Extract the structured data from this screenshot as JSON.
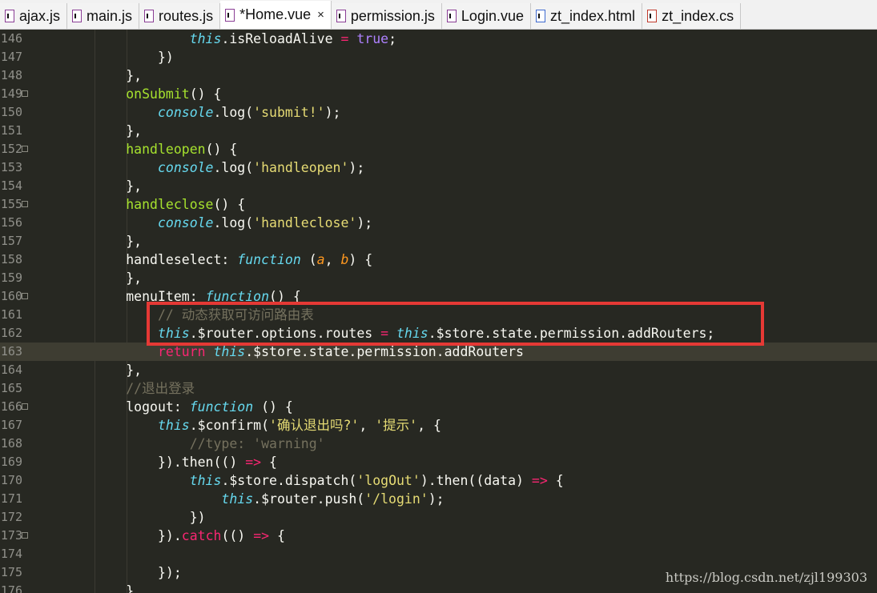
{
  "tabs": [
    {
      "label": "ajax.js",
      "icon": "js-file-icon",
      "active": false
    },
    {
      "label": "main.js",
      "icon": "js-file-icon",
      "active": false
    },
    {
      "label": "routes.js",
      "icon": "js-file-icon",
      "active": false
    },
    {
      "label": "*Home.vue",
      "icon": "vue-file-icon",
      "active": true,
      "close": "×"
    },
    {
      "label": "permission.js",
      "icon": "js-file-icon",
      "active": false
    },
    {
      "label": "Login.vue",
      "icon": "vue-file-icon",
      "active": false
    },
    {
      "label": "zt_index.html",
      "icon": "html-file-icon",
      "active": false
    },
    {
      "label": "zt_index.cs",
      "icon": "css-file-icon",
      "active": false
    }
  ],
  "lines": [
    {
      "n": "146",
      "fold": false,
      "indent": "        ",
      "tokens": [
        [
          "this",
          "this"
        ],
        [
          ".isReloadAlive ",
          "plain"
        ],
        [
          "=",
          "op"
        ],
        [
          " ",
          "plain"
        ],
        [
          "true",
          "bool"
        ],
        [
          ";",
          "plain"
        ]
      ]
    },
    {
      "n": "147",
      "fold": false,
      "indent": "    ",
      "tokens": [
        [
          "})",
          "plain"
        ]
      ]
    },
    {
      "n": "148",
      "fold": false,
      "indent": "",
      "tokens": [
        [
          "},",
          "plain"
        ]
      ]
    },
    {
      "n": "149",
      "fold": true,
      "indent": "",
      "tokens": [
        [
          "onSubmit",
          "fn"
        ],
        [
          "() {",
          "plain"
        ]
      ]
    },
    {
      "n": "150",
      "fold": false,
      "indent": "    ",
      "tokens": [
        [
          "console",
          "this"
        ],
        [
          ".log(",
          "plain"
        ],
        [
          "'submit!'",
          "str"
        ],
        [
          ");",
          "plain"
        ]
      ]
    },
    {
      "n": "151",
      "fold": false,
      "indent": "",
      "tokens": [
        [
          "},",
          "plain"
        ]
      ]
    },
    {
      "n": "152",
      "fold": true,
      "indent": "",
      "tokens": [
        [
          "handleopen",
          "fn"
        ],
        [
          "() {",
          "plain"
        ]
      ]
    },
    {
      "n": "153",
      "fold": false,
      "indent": "    ",
      "tokens": [
        [
          "console",
          "this"
        ],
        [
          ".log(",
          "plain"
        ],
        [
          "'handleopen'",
          "str"
        ],
        [
          ");",
          "plain"
        ]
      ]
    },
    {
      "n": "154",
      "fold": false,
      "indent": "",
      "tokens": [
        [
          "},",
          "plain"
        ]
      ]
    },
    {
      "n": "155",
      "fold": true,
      "indent": "",
      "tokens": [
        [
          "handleclose",
          "fn"
        ],
        [
          "() {",
          "plain"
        ]
      ]
    },
    {
      "n": "156",
      "fold": false,
      "indent": "    ",
      "tokens": [
        [
          "console",
          "this"
        ],
        [
          ".log(",
          "plain"
        ],
        [
          "'handleclose'",
          "str"
        ],
        [
          ");",
          "plain"
        ]
      ]
    },
    {
      "n": "157",
      "fold": false,
      "indent": "",
      "tokens": [
        [
          "},",
          "plain"
        ]
      ]
    },
    {
      "n": "158",
      "fold": false,
      "indent": "",
      "tokens": [
        [
          "handleselect: ",
          "plain"
        ],
        [
          "function",
          "this"
        ],
        [
          " (",
          "plain"
        ],
        [
          "a",
          "param"
        ],
        [
          ", ",
          "plain"
        ],
        [
          "b",
          "param"
        ],
        [
          ") {",
          "plain"
        ]
      ]
    },
    {
      "n": "159",
      "fold": false,
      "indent": "",
      "tokens": [
        [
          "},",
          "plain"
        ]
      ]
    },
    {
      "n": "160",
      "fold": true,
      "indent": "",
      "tokens": [
        [
          "menuItem: ",
          "plain"
        ],
        [
          "function",
          "this"
        ],
        [
          "() {",
          "plain"
        ]
      ]
    },
    {
      "n": "161",
      "fold": false,
      "indent": "    ",
      "tokens": [
        [
          "// 动态获取可访问路由表",
          "com"
        ]
      ]
    },
    {
      "n": "162",
      "fold": false,
      "indent": "    ",
      "tokens": [
        [
          "this",
          "this"
        ],
        [
          ".$router.options.routes ",
          "plain"
        ],
        [
          "=",
          "op"
        ],
        [
          " ",
          "plain"
        ],
        [
          "this",
          "this"
        ],
        [
          ".$store.state.permission.addRouters;",
          "plain"
        ]
      ]
    },
    {
      "n": "163",
      "fold": false,
      "indent": "    ",
      "current": true,
      "tokens": [
        [
          "return",
          "key"
        ],
        [
          " ",
          "plain"
        ],
        [
          "this",
          "this"
        ],
        [
          ".$store.state.permission.addRouters",
          "plain"
        ]
      ]
    },
    {
      "n": "164",
      "fold": false,
      "indent": "",
      "tokens": [
        [
          "},",
          "plain"
        ]
      ]
    },
    {
      "n": "165",
      "fold": false,
      "indent": "",
      "tokens": [
        [
          "//退出登录",
          "com"
        ]
      ]
    },
    {
      "n": "166",
      "fold": true,
      "indent": "",
      "tokens": [
        [
          "logout: ",
          "plain"
        ],
        [
          "function",
          "this"
        ],
        [
          " () {",
          "plain"
        ]
      ]
    },
    {
      "n": "167",
      "fold": false,
      "indent": "    ",
      "tokens": [
        [
          "this",
          "this"
        ],
        [
          ".$confirm(",
          "plain"
        ],
        [
          "'确认退出吗?'",
          "str"
        ],
        [
          ", ",
          "plain"
        ],
        [
          "'提示'",
          "str"
        ],
        [
          ", {",
          "plain"
        ]
      ]
    },
    {
      "n": "168",
      "fold": false,
      "indent": "        ",
      "tokens": [
        [
          "//type: 'warning'",
          "com"
        ]
      ]
    },
    {
      "n": "169",
      "fold": false,
      "indent": "    ",
      "tokens": [
        [
          "}).then(() ",
          "plain"
        ],
        [
          "=>",
          "op"
        ],
        [
          " {",
          "plain"
        ]
      ]
    },
    {
      "n": "170",
      "fold": false,
      "indent": "        ",
      "tokens": [
        [
          "this",
          "this"
        ],
        [
          ".$store.dispatch(",
          "plain"
        ],
        [
          "'logOut'",
          "str"
        ],
        [
          ").then((data) ",
          "plain"
        ],
        [
          "=>",
          "op"
        ],
        [
          " {",
          "plain"
        ]
      ]
    },
    {
      "n": "171",
      "fold": false,
      "indent": "            ",
      "tokens": [
        [
          "this",
          "this"
        ],
        [
          ".$router.push(",
          "plain"
        ],
        [
          "'/login'",
          "str"
        ],
        [
          ");",
          "plain"
        ]
      ]
    },
    {
      "n": "172",
      "fold": false,
      "indent": "        ",
      "tokens": [
        [
          "})",
          "plain"
        ]
      ]
    },
    {
      "n": "173",
      "fold": true,
      "indent": "    ",
      "tokens": [
        [
          "}).",
          "plain"
        ],
        [
          "catch",
          "key"
        ],
        [
          "(() ",
          "plain"
        ],
        [
          "=>",
          "op"
        ],
        [
          " {",
          "plain"
        ]
      ]
    },
    {
      "n": "174",
      "fold": false,
      "indent": "",
      "tokens": []
    },
    {
      "n": "175",
      "fold": false,
      "indent": "    ",
      "tokens": [
        [
          "});",
          "plain"
        ]
      ]
    },
    {
      "n": "176",
      "fold": false,
      "indent": "",
      "tokens": [
        [
          "}",
          "plain"
        ]
      ]
    }
  ],
  "base_indent": "            ",
  "watermark": "https://blog.csdn.net/zjl199303"
}
